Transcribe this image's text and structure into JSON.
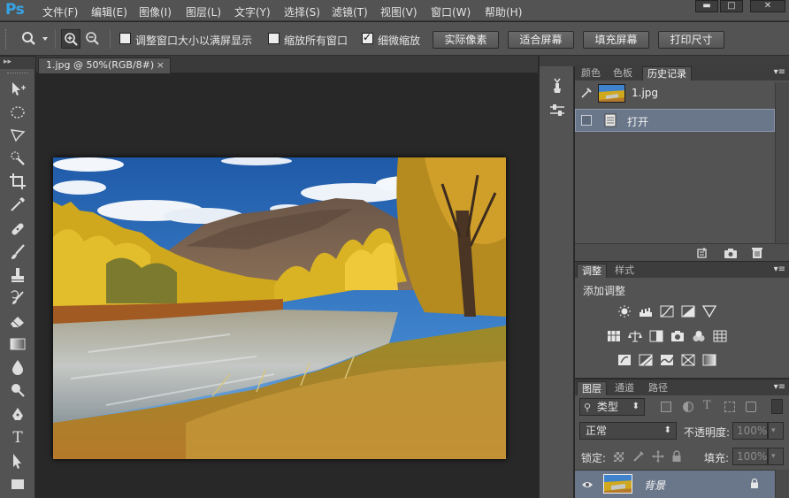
{
  "app": {
    "logo": "Ps",
    "menu": [
      "文件(F)",
      "编辑(E)",
      "图像(I)",
      "图层(L)",
      "文字(Y)",
      "选择(S)",
      "滤镜(T)",
      "视图(V)",
      "窗口(W)",
      "帮助(H)"
    ],
    "window_controls": {
      "minimize": "▬",
      "maximize": "□",
      "close": "✕"
    }
  },
  "options": {
    "resize_windows_label": "调整窗口大小以满屏显示",
    "resize_windows_checked": false,
    "zoom_all_label": "缩放所有窗口",
    "zoom_all_checked": false,
    "scrubby_zoom_label": "细微缩放",
    "scrubby_zoom_checked": true,
    "actual_pixels": "实际像素",
    "fit_screen": "适合屏幕",
    "fill_screen": "填充屏幕",
    "print_size": "打印尺寸"
  },
  "document": {
    "tab_title": "1.jpg @ 50%(RGB/8#)",
    "close_glyph": "×"
  },
  "history_panel": {
    "tabs": [
      "颜色",
      "色板",
      "历史记录"
    ],
    "active_tab": "历史记录",
    "snapshot_name": "1.jpg",
    "states": [
      {
        "label": "打开",
        "selected": true
      }
    ]
  },
  "adjustments_panel": {
    "tabs": [
      "调整",
      "样式"
    ],
    "active_tab": "调整",
    "heading": "添加调整"
  },
  "layers_panel": {
    "tabs": [
      "图层",
      "通道",
      "路径"
    ],
    "active_tab": "图层",
    "filter_label": "类型",
    "blend_mode": "正常",
    "opacity_label": "不透明度:",
    "opacity_value": "100%",
    "lock_label": "锁定:",
    "fill_label": "填充:",
    "fill_value": "100%",
    "layers": [
      {
        "name": "背景",
        "locked": true,
        "visible": true
      }
    ]
  },
  "colors": {
    "chrome": "#535353",
    "canvas_bg": "#282828",
    "ps_blue": "#36a4e6",
    "selection": "#6a778a"
  }
}
